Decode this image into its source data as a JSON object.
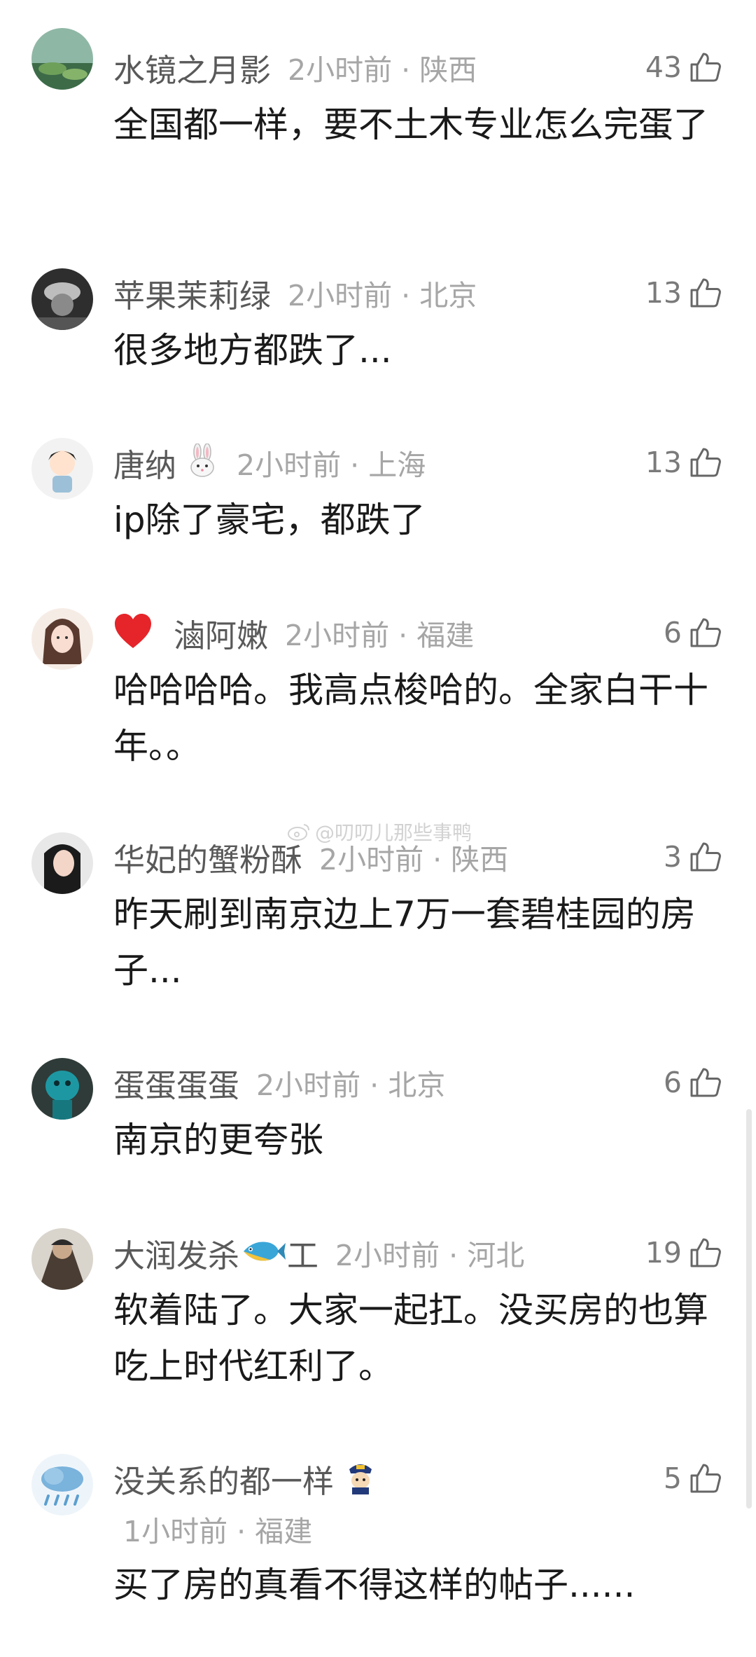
{
  "comments": [
    {
      "user": "水镜之月影",
      "time": "2小时前",
      "location": "陕西",
      "likes": "43",
      "text": "全国都一样，要不土木专业怎么完蛋了"
    },
    {
      "user": "苹果茉莉绿",
      "time": "2小时前",
      "location": "北京",
      "likes": "13",
      "text": "很多地方都跌了..."
    },
    {
      "user": "唐纳",
      "time": "2小时前",
      "location": "上海",
      "likes": "13",
      "text": "ip除了豪宅，都跌了",
      "badge": "rabbit-emoji"
    },
    {
      "user": "滷阿嫩",
      "time": "2小时前",
      "location": "福建",
      "likes": "6",
      "text": "哈哈哈哈。我高点梭哈的。全家白干十年。。",
      "prefix": "heart-emoji"
    },
    {
      "user": "华妃的蟹粉酥",
      "time": "2小时前",
      "location": "陕西",
      "likes": "3",
      "text": "昨天刷到南京边上7万一套碧桂园的房子..."
    },
    {
      "user": "蛋蛋蛋蛋",
      "time": "2小时前",
      "location": "北京",
      "likes": "6",
      "text": "南京的更夸张"
    },
    {
      "user_pre": "大润发杀",
      "user_post": "工",
      "time": "2小时前",
      "location": "河北",
      "likes": "19",
      "text": "软着陆了。大家一起扛。没买房的也算吃上时代红利了。",
      "badge": "fish-emoji"
    },
    {
      "user": "没关系的都一样",
      "time": "1小时前",
      "location": "福建",
      "likes": "5",
      "text": "买了房的真看不得这样的帖子......",
      "badge": "police-emoji"
    }
  ],
  "separator": "·",
  "watermark": "@叨叨儿那些事鸭",
  "icons": {
    "like": "thumbs-up-icon",
    "watermark": "weibo-icon"
  }
}
